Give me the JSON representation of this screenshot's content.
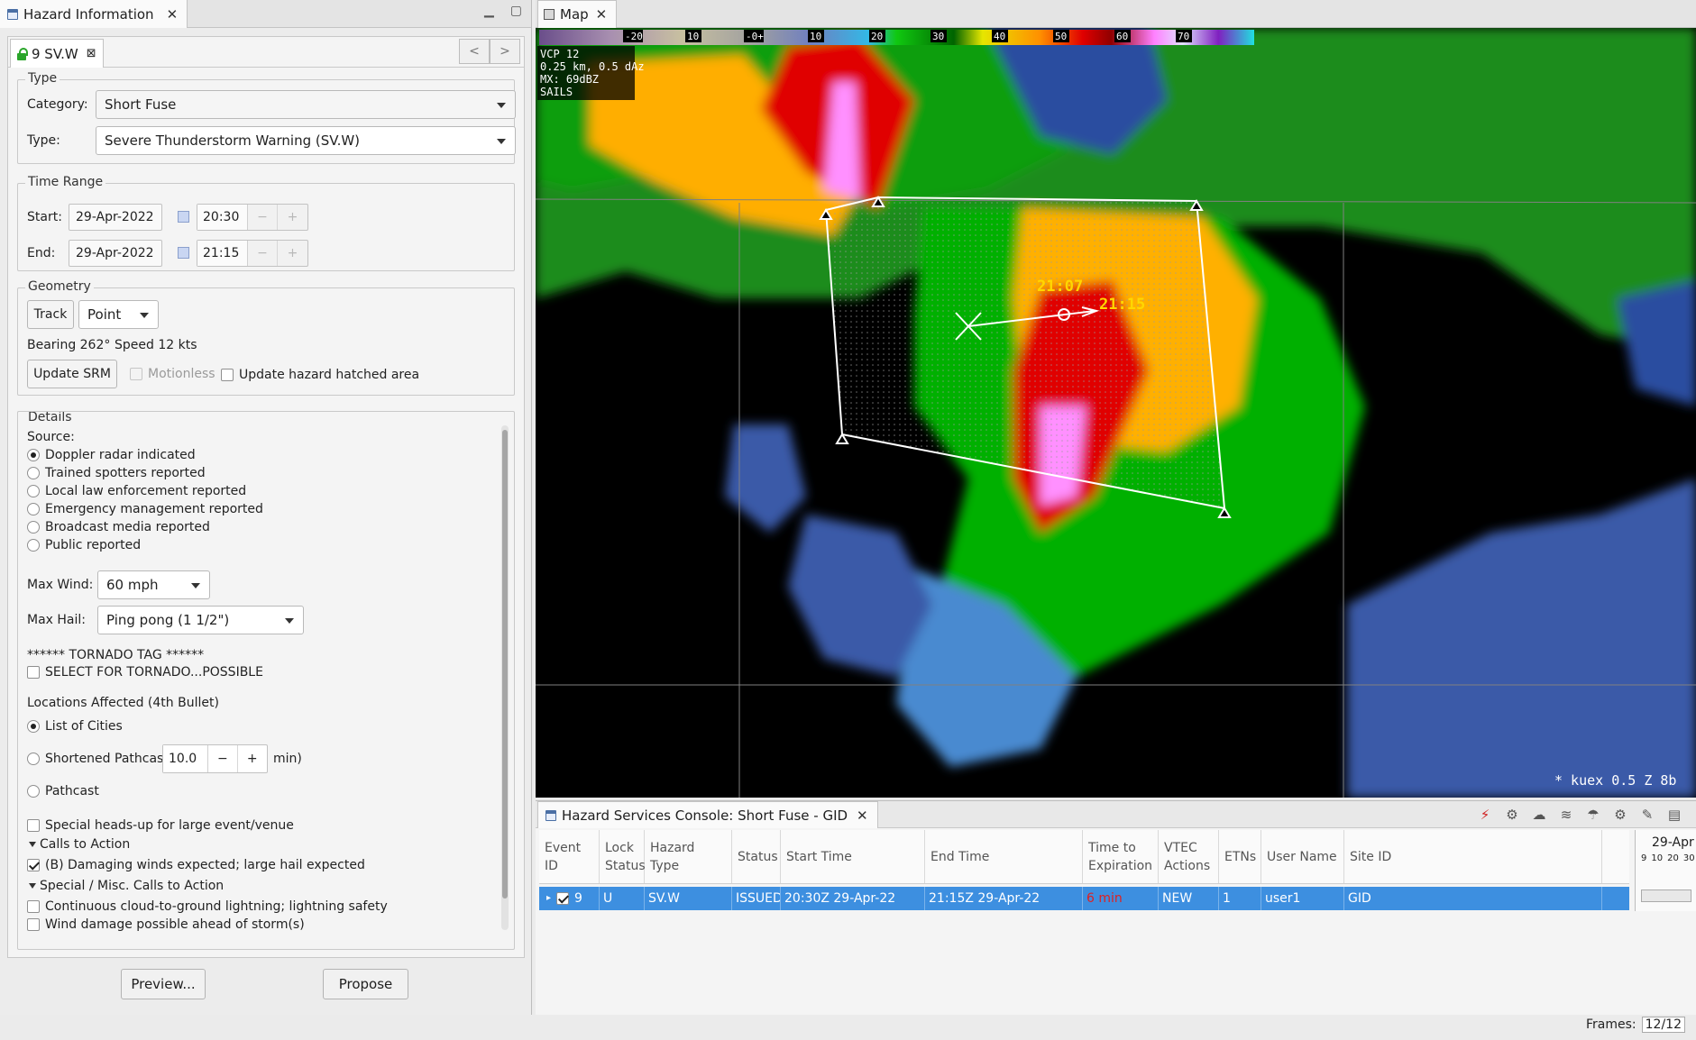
{
  "left_view": {
    "title": "Hazard Information",
    "minimize": "▁",
    "maximize": "▢"
  },
  "hazard_tab": {
    "label": "9 SV.W",
    "prev": "<",
    "next": ">"
  },
  "type_group": {
    "legend": "Type",
    "category_label": "Category:",
    "category_value": "Short Fuse",
    "type_label": "Type:",
    "type_value": "Severe Thunderstorm Warning (SV.W)"
  },
  "time_range": {
    "legend": "Time Range",
    "start_label": "Start:",
    "start_date": "29-Apr-2022",
    "start_time": "20:30",
    "end_label": "End:",
    "end_date": "29-Apr-2022",
    "end_time": "21:15",
    "minus": "−",
    "plus": "+"
  },
  "geometry": {
    "legend": "Geometry",
    "track_button": "Track",
    "shape_value": "Point",
    "bearing": "Bearing 262°",
    "speed": "Speed 12 kts",
    "update_srm": "Update SRM",
    "motionless": "Motionless",
    "update_hatched": "Update hazard hatched area"
  },
  "details": {
    "legend": "Details",
    "source_label": "Source:",
    "sources": [
      "Doppler radar indicated",
      "Trained spotters reported",
      "Local law enforcement reported",
      "Emergency management reported",
      "Broadcast media reported",
      "Public reported"
    ],
    "max_wind_label": "Max Wind:",
    "max_wind_value": "60 mph",
    "max_hail_label": "Max Hail:",
    "max_hail_value": "Ping pong (1 1/2\")",
    "tornado_tag": "****** TORNADO TAG ******",
    "tornado_possible": "SELECT FOR TORNADO...POSSIBLE",
    "locations_label": "Locations Affected (4th Bullet)",
    "list_of_cities": "List of Cities",
    "shortened_pathcast": "Shortened Pathcast (",
    "pathcast_value": "10.0",
    "pathcast_unit": "min)",
    "pathcast": "Pathcast",
    "special_headsup": "Special heads-up for large event/venue",
    "calls_to_action": "Calls to Action",
    "cta_damaging": "(B) Damaging winds expected; large hail expected",
    "special_misc": "Special / Misc. Calls to Action",
    "cta_lightning": "Continuous cloud-to-ground lightning; lightning safety",
    "cta_wind_damage": "Wind damage possible ahead of storm(s)"
  },
  "footer": {
    "preview": "Preview...",
    "propose": "Propose"
  },
  "map": {
    "tab_label": "Map",
    "colorbar_ticks": [
      "-20",
      "10",
      "-0+",
      "10",
      "20",
      "30",
      "40",
      "50",
      "60",
      "70"
    ],
    "info_lines": [
      "VCP 12",
      "0.25 km, 0.5 dAz",
      "MX: 69dBZ",
      "SAILS"
    ],
    "time_label_1": "21:07",
    "time_label_2": "21:15",
    "product_label": "* kuex 0.5  Z 8b"
  },
  "console": {
    "title": "Hazard Services Console: Short Fuse - GID",
    "columns": [
      "Event ID",
      "Lock Status",
      "Hazard Type",
      "Status",
      "Start Time",
      "End Time",
      "Time to Expiration",
      "VTEC Actions",
      "ETNs",
      "User Name",
      "Site ID"
    ],
    "row": {
      "event_id": "9",
      "lock": "U",
      "hazard_type": "SV.W",
      "status": "ISSUED",
      "start": "20:30Z 29-Apr-22",
      "end": "21:15Z 29-Apr-22",
      "expiration": "6 min",
      "vtec": "NEW",
      "etns": "1",
      "user": "user1",
      "site": "GID"
    },
    "timeline_date": "29-Apr",
    "timeline_ticks": [
      "9",
      "10",
      "20",
      "30"
    ]
  },
  "status_bar": {
    "frames_label": "Frames:",
    "frames_value": "12/12"
  },
  "colors": {
    "accent": "#3d8fe0",
    "expiration": "#e02020",
    "label_yellow": "#ffd700"
  }
}
